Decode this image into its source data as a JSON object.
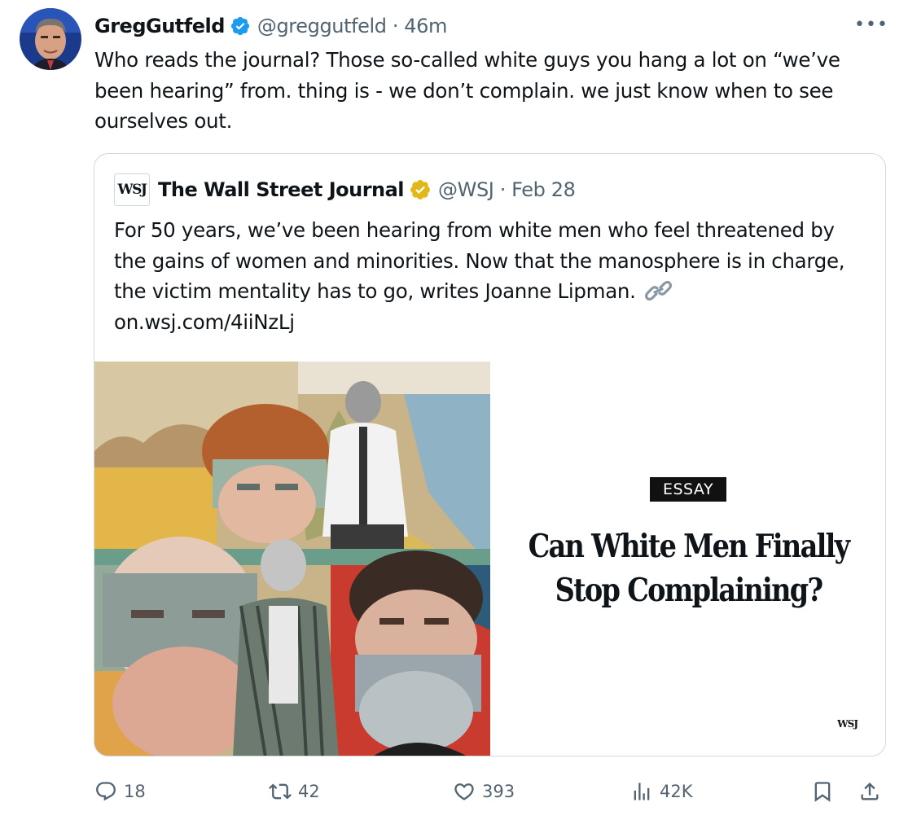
{
  "tweet": {
    "display_name": "GregGutfeld",
    "handle_time": "@greggutfeld · 46m",
    "text": "Who reads the journal? Those so-called white guys you hang a lot on “we’ve been hearing” from. thing is - we don’t complain. we just know when to see ourselves out."
  },
  "quote": {
    "logo_text": "WSJ",
    "display_name": "The Wall Street Journal",
    "handle_time": "@WSJ · Feb 28",
    "text": "For 50 years, we’ve been hearing from white men who feel threatened by the gains of women and minorities. Now that the manosphere is in charge, the victim mentality has to go, writes Joanne Lipman.",
    "link": "on.wsj.com/4iiNzLj",
    "media": {
      "badge": "ESSAY",
      "title_line1": "Can White Men Finally",
      "title_line2": "Stop Complaining?",
      "brand": "WSJ"
    }
  },
  "actions": {
    "replies": "18",
    "reposts": "42",
    "likes": "393",
    "views": "42K"
  },
  "colors": {
    "text": "#0f1419",
    "secondary": "#536471",
    "verified_blue": "#1d9bf0",
    "verified_gold": "#e2b719",
    "border": "#cfd9de"
  },
  "icons": [
    "more-icon",
    "verified-icon",
    "gold-verified-icon",
    "link-icon",
    "reply-icon",
    "repost-icon",
    "like-icon",
    "views-icon",
    "bookmark-icon",
    "share-icon"
  ]
}
